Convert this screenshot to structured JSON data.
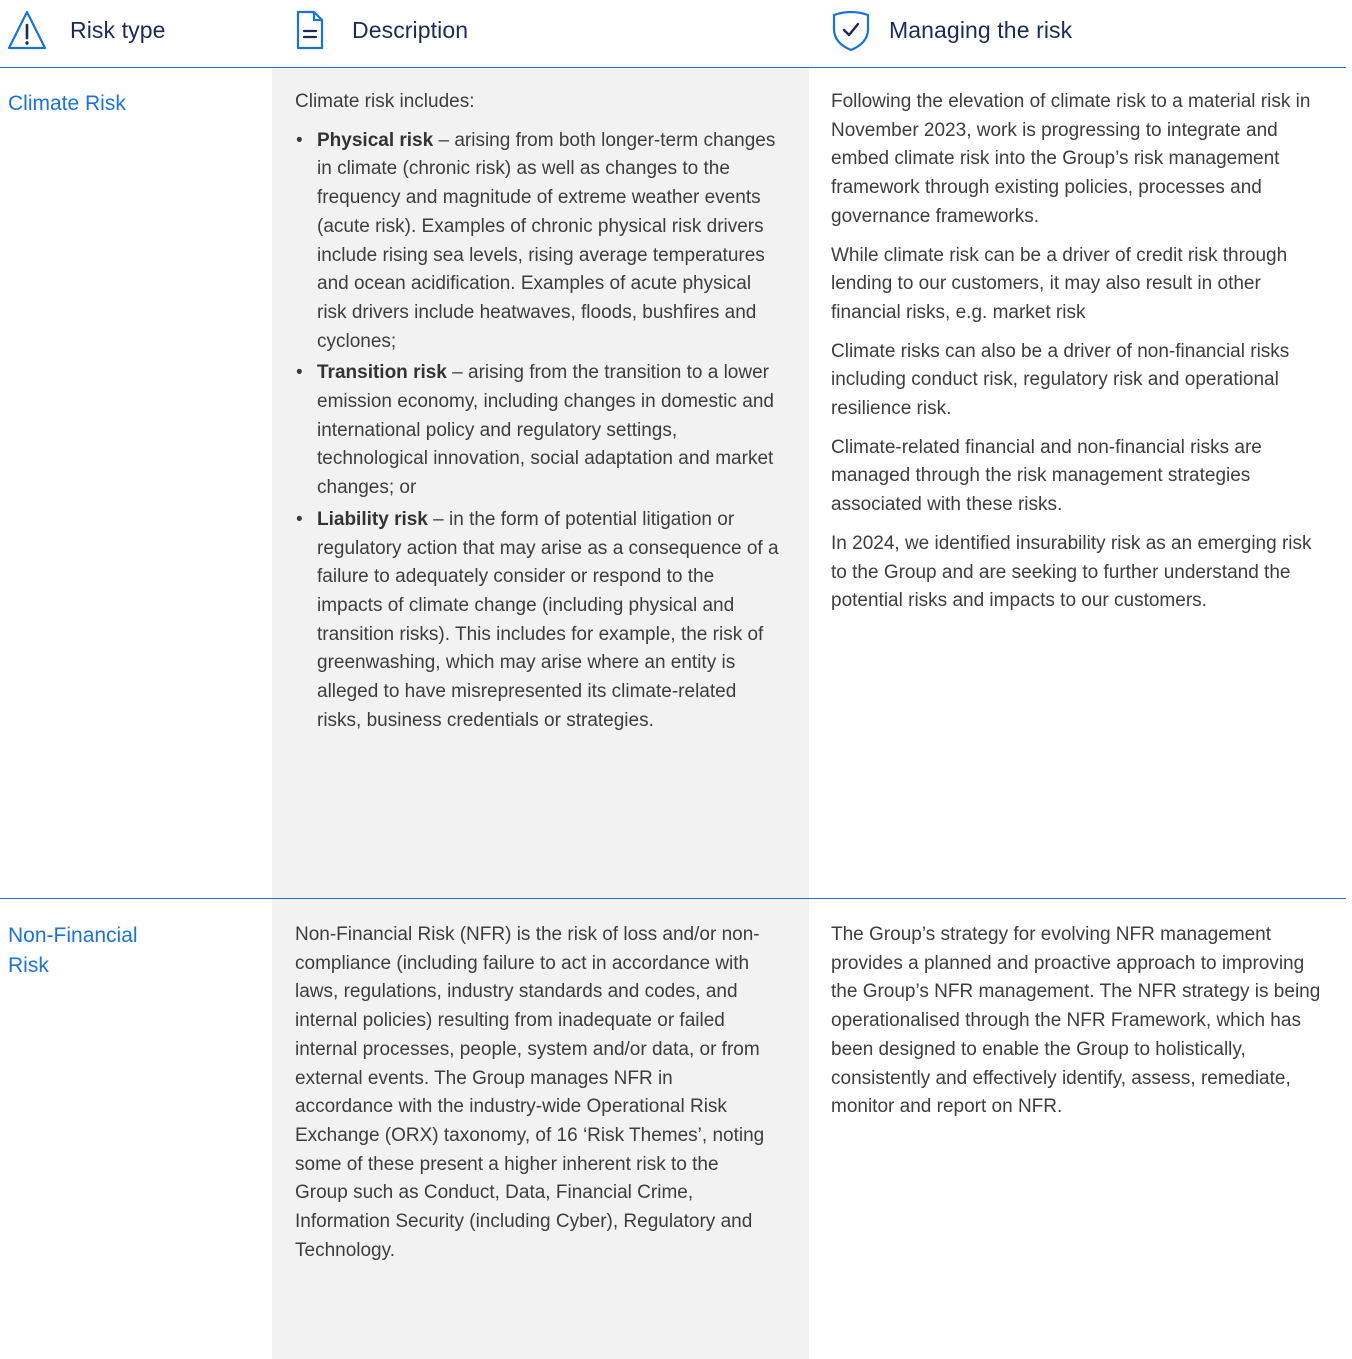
{
  "header": {
    "risk_type_label": "Risk type",
    "description_label": "Description",
    "managing_label": "Managing the risk",
    "icons": [
      "warning-triangle-icon",
      "document-icon",
      "shield-check-icon"
    ],
    "accent_color": "#1a73d9",
    "heading_color": "#1d2a56"
  },
  "rows": [
    {
      "name": "Climate Risk",
      "description": {
        "intro": "Climate risk includes:",
        "bullets": [
          {
            "term": "Physical risk",
            "text": " – arising from both longer-term changes in climate (chronic risk) as well as changes to the frequency and magnitude of extreme weather events (acute risk). Examples of chronic physical risk drivers include rising sea levels, rising average temperatures and ocean acidification. Examples of acute physical risk drivers include heatwaves, floods, bushfires and cyclones;"
          },
          {
            "term": "Transition risk",
            "text": " – arising from the transition to a lower emission economy, including changes in domestic and international policy and regulatory settings, technological innovation, social adaptation and market changes; or"
          },
          {
            "term": "Liability risk",
            "text": " – in the form of potential litigation or regulatory action that may arise as a consequence of a failure to adequately consider or respond to the impacts of climate change (including physical and transition risks). This includes for example, the risk of greenwashing, which may arise where an entity is alleged to have misrepresented its climate-related risks, business credentials or strategies."
          }
        ]
      },
      "managing": [
        "Following the elevation of climate risk to a material risk in November 2023, work is progressing to integrate and embed climate risk into the Group’s risk management framework through existing policies, processes and governance frameworks.",
        "While climate risk can be a driver of credit risk through lending to our customers, it may also result in other financial risks, e.g. market risk",
        "Climate risks can also be a driver of non-financial risks including conduct risk, regulatory risk and operational resilience risk.",
        "Climate-related financial and non-financial risks are managed through the risk management strategies associated with these risks.",
        "In 2024, we identified insurability risk as an emerging risk to the Group and are seeking to further understand the potential risks and impacts to our customers."
      ]
    },
    {
      "name": "Non-Financial Risk",
      "description": {
        "intro": "Non-Financial Risk (NFR) is the risk of loss and/or non-compliance (including failure to act in accordance with laws, regulations, industry standards and codes, and internal policies) resulting from inadequate or failed internal processes, people, system and/or data, or from external events. The Group manages NFR in accordance with the industry-wide Operational Risk Exchange (ORX) taxonomy, of 16 ‘Risk Themes’, noting some of these present a higher inherent risk to the Group such as Conduct, Data, Financial Crime, Information Security (including Cyber), Regulatory and Technology."
      },
      "managing": [
        "The Group’s strategy for evolving NFR management provides a planned and proactive approach to improving the Group’s NFR management. The NFR strategy is being operationalised through the NFR Framework, which has been designed to enable the Group to holistically, consistently and effectively identify, assess, remediate, monitor and report on NFR."
      ]
    }
  ]
}
